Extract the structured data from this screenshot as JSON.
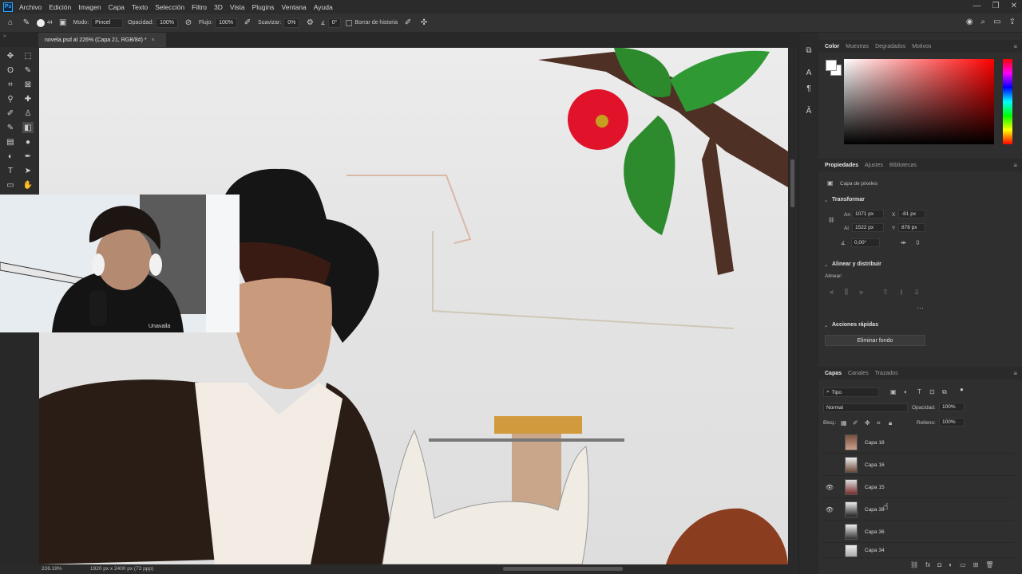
{
  "menubar": {
    "items": [
      "Archivo",
      "Edición",
      "Imagen",
      "Capa",
      "Texto",
      "Selección",
      "Filtro",
      "3D",
      "Vista",
      "Plugins",
      "Ventana",
      "Ayuda"
    ]
  },
  "options": {
    "brush_size": "44",
    "modo_label": "Modo:",
    "modo_value": "Pincel",
    "opacidad_label": "Opacidad:",
    "opacidad_value": "100%",
    "flujo_label": "Flujo:",
    "flujo_value": "100%",
    "suavizar_label": "Suavizar:",
    "suavizar_value": "0%",
    "angle_value": "0°",
    "borrar_historia": "Borrar de historia"
  },
  "document": {
    "tab_title": "novela.psd al 226% (Capa 21, RGB/8#) *",
    "zoom": "226.19%",
    "info": "1920 px x 2400 px (72 ppp)"
  },
  "color_panel": {
    "tabs": [
      "Color",
      "Muestras",
      "Degradados",
      "Motivos"
    ],
    "active": "Color"
  },
  "properties": {
    "tabs": [
      "Propiedades",
      "Ajustes",
      "Bibliotecas"
    ],
    "layer_type": "Capa de píxeles",
    "transform_title": "Transformar",
    "an_label": "An",
    "an_value": "1071 px",
    "x_label": "X",
    "x_value": "-81 px",
    "al_label": "Al",
    "al_value": "1522 px",
    "y_label": "Y",
    "y_value": "878 px",
    "angle_value": "0,00°",
    "align_title": "Alinear y distribuir",
    "align_sub": "Alinear:",
    "quick_title": "Acciones rápidas",
    "remove_bg": "Eliminar fondo"
  },
  "layers_panel": {
    "tabs": [
      "Capas",
      "Canales",
      "Trazados"
    ],
    "filter": "Tipo",
    "blend": "Normal",
    "opacity_label": "Opacidad:",
    "opacity_value": "100%",
    "lock_label": "Bloq.:",
    "fill_label": "Relleno:",
    "fill_value": "100%",
    "layers": [
      {
        "name": "Capa 18",
        "visible": false
      },
      {
        "name": "Capa 16",
        "visible": false
      },
      {
        "name": "Capa 15",
        "visible": true
      },
      {
        "name": "Capa 38",
        "visible": true
      },
      {
        "name": "Capa 36",
        "visible": false
      },
      {
        "name": "Capa 34",
        "visible": false
      }
    ]
  },
  "webcam": {
    "hoodie_text": "Unavaila"
  },
  "colors": {
    "accent": "#31a8ff",
    "panel_bg": "#2f2f2f",
    "canvas_bg": "#e6e6e6"
  }
}
